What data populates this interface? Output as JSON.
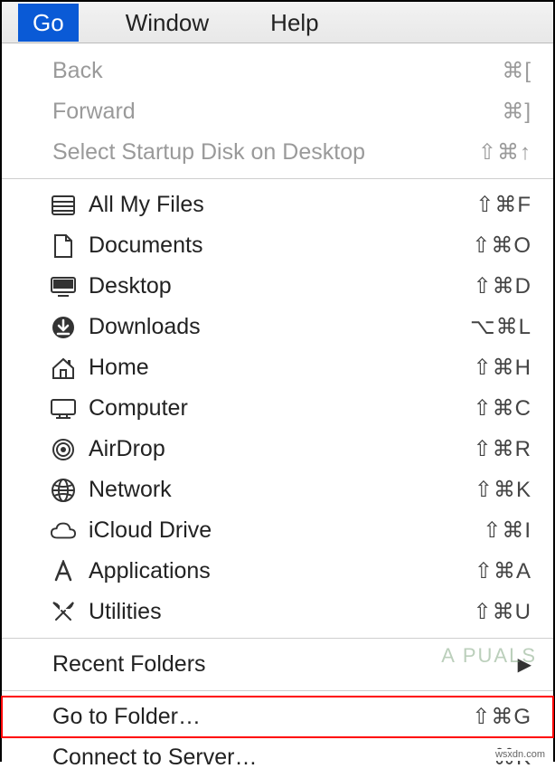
{
  "menubar": {
    "go": "Go",
    "window": "Window",
    "help": "Help"
  },
  "section_nav": {
    "back": {
      "label": "Back",
      "shortcut": "⌘["
    },
    "forward": {
      "label": "Forward",
      "shortcut": "⌘]"
    },
    "startup": {
      "label": "Select Startup Disk on Desktop",
      "shortcut": "⇧⌘↑"
    }
  },
  "section_places": {
    "allfiles": {
      "label": "All My Files",
      "shortcut": "⇧⌘F"
    },
    "documents": {
      "label": "Documents",
      "shortcut": "⇧⌘O"
    },
    "desktop": {
      "label": "Desktop",
      "shortcut": "⇧⌘D"
    },
    "downloads": {
      "label": "Downloads",
      "shortcut": "⌥⌘L"
    },
    "home": {
      "label": "Home",
      "shortcut": "⇧⌘H"
    },
    "computer": {
      "label": "Computer",
      "shortcut": "⇧⌘C"
    },
    "airdrop": {
      "label": "AirDrop",
      "shortcut": "⇧⌘R"
    },
    "network": {
      "label": "Network",
      "shortcut": "⇧⌘K"
    },
    "icloud": {
      "label": "iCloud Drive",
      "shortcut": "⇧⌘I"
    },
    "applications": {
      "label": "Applications",
      "shortcut": "⇧⌘A"
    },
    "utilities": {
      "label": "Utilities",
      "shortcut": "⇧⌘U"
    }
  },
  "section_bottom": {
    "recent": {
      "label": "Recent Folders"
    },
    "gotofolder": {
      "label": "Go to Folder…",
      "shortcut": "⇧⌘G"
    },
    "connect": {
      "label": "Connect to Server…",
      "shortcut": "⌘K"
    }
  },
  "watermark": "A  PUALS",
  "credit": "wsxdn.com"
}
